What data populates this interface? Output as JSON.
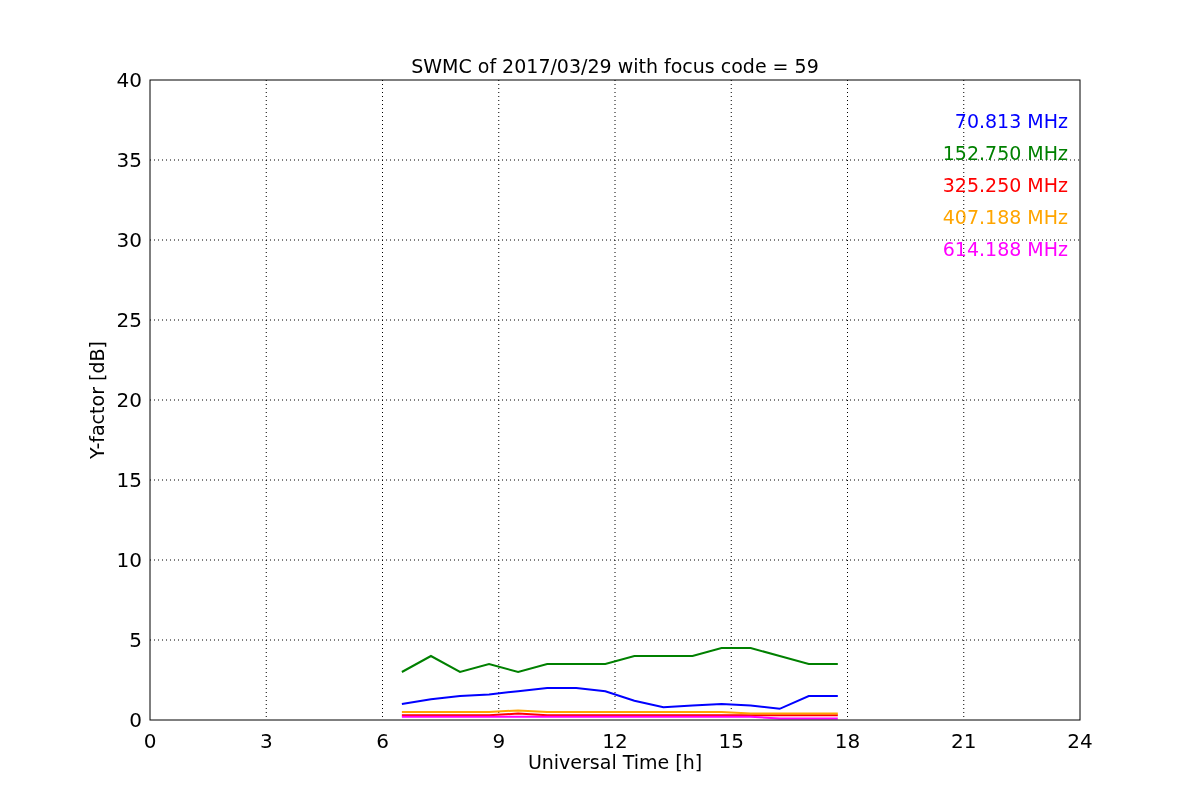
{
  "figure": {
    "chart_data": {
      "type": "line",
      "title": "SWMC of 2017/03/29 with focus code = 59",
      "xlabel": "Universal Time [h]",
      "ylabel": "Y-factor [dB]",
      "x": [
        6.5,
        7.25,
        8,
        8.75,
        9.5,
        10.25,
        11,
        11.75,
        12.5,
        13.25,
        14,
        14.75,
        15.5,
        16.25,
        17,
        17.75
      ],
      "series": [
        {
          "name": "70.813 MHz",
          "color": "#0000ff",
          "values": [
            1.0,
            1.3,
            1.5,
            1.6,
            1.8,
            2.0,
            2.0,
            1.8,
            1.2,
            0.8,
            0.9,
            1.0,
            0.9,
            0.7,
            1.5,
            1.5
          ]
        },
        {
          "name": "152.750 MHz",
          "color": "#008000",
          "values": [
            3.0,
            4.0,
            3.0,
            3.5,
            3.0,
            3.5,
            3.5,
            3.5,
            4.0,
            4.0,
            4.0,
            4.5,
            4.5,
            4.0,
            3.5,
            3.5
          ]
        },
        {
          "name": "325.250 MHz",
          "color": "#ff0000",
          "values": [
            0.3,
            0.3,
            0.3,
            0.3,
            0.4,
            0.3,
            0.3,
            0.3,
            0.3,
            0.3,
            0.3,
            0.3,
            0.3,
            0.3,
            0.3,
            0.3
          ]
        },
        {
          "name": "407.188 MHz",
          "color": "#ffa500",
          "values": [
            0.5,
            0.5,
            0.5,
            0.5,
            0.6,
            0.5,
            0.5,
            0.5,
            0.5,
            0.5,
            0.5,
            0.5,
            0.4,
            0.4,
            0.4,
            0.4
          ]
        },
        {
          "name": "614.188 MHz",
          "color": "#ff00ff",
          "values": [
            0.2,
            0.2,
            0.2,
            0.2,
            0.2,
            0.2,
            0.2,
            0.2,
            0.2,
            0.2,
            0.2,
            0.2,
            0.2,
            0.1,
            0.1,
            0.1
          ]
        }
      ],
      "xlim": [
        0,
        24
      ],
      "ylim": [
        0,
        40
      ],
      "xticks": [
        0,
        3,
        6,
        9,
        12,
        15,
        18,
        21,
        24
      ],
      "yticks": [
        0,
        5,
        10,
        15,
        20,
        25,
        30,
        35,
        40
      ],
      "grid": true
    }
  }
}
